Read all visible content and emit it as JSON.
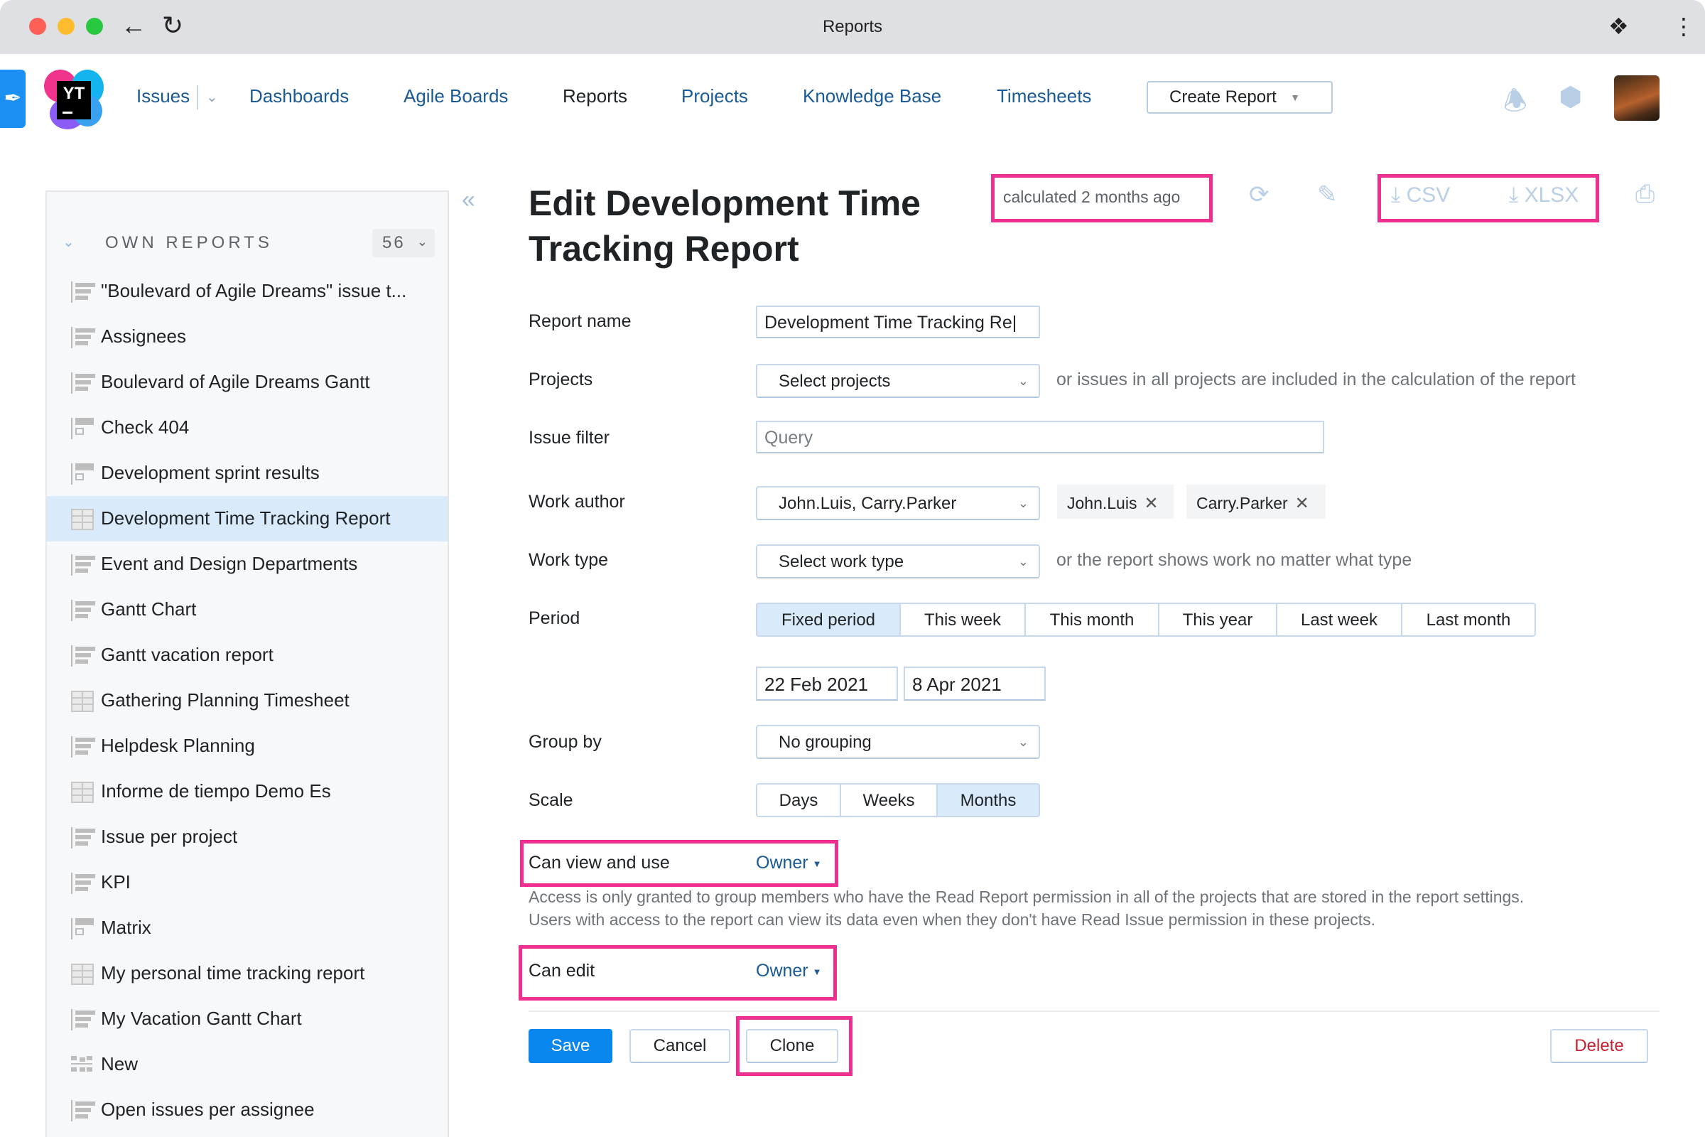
{
  "browser": {
    "title": "Reports",
    "back_icon": "arrow-left-icon",
    "reload_icon": "reload-icon",
    "extensions_icon": "puzzle-icon",
    "menu_icon": "kebab-menu-icon"
  },
  "header": {
    "logo_text": "YT",
    "nav": [
      {
        "label": "Issues",
        "active": false
      },
      {
        "label": "Dashboards",
        "active": false
      },
      {
        "label": "Agile Boards",
        "active": false
      },
      {
        "label": "Reports",
        "active": true
      },
      {
        "label": "Projects",
        "active": false
      },
      {
        "label": "Knowledge Base",
        "active": false
      },
      {
        "label": "Timesheets",
        "active": false
      }
    ],
    "create_button": "Create Report",
    "icons": [
      "bell-icon",
      "settings-icon",
      "avatar"
    ]
  },
  "sidebar": {
    "section_title": "OWN REPORTS",
    "count": "56",
    "items": [
      {
        "label": "\"Boulevard of Agile Dreams\" issue t...",
        "icon": "bar"
      },
      {
        "label": "Assignees",
        "icon": "bar"
      },
      {
        "label": "Boulevard of Agile Dreams Gantt",
        "icon": "bar"
      },
      {
        "label": "Check 404",
        "icon": "matrix"
      },
      {
        "label": "Development sprint results",
        "icon": "matrix"
      },
      {
        "label": "Development Time Tracking Report",
        "icon": "table",
        "selected": true
      },
      {
        "label": "Event and Design Departments",
        "icon": "bar"
      },
      {
        "label": "Gantt Chart",
        "icon": "bar"
      },
      {
        "label": "Gantt vacation report",
        "icon": "bar"
      },
      {
        "label": "Gathering Planning Timesheet",
        "icon": "table"
      },
      {
        "label": "Helpdesk Planning",
        "icon": "bar"
      },
      {
        "label": "Informe de tiempo Demo Es",
        "icon": "table"
      },
      {
        "label": "Issue per project",
        "icon": "bar"
      },
      {
        "label": "KPI",
        "icon": "bar"
      },
      {
        "label": "Matrix",
        "icon": "matrix"
      },
      {
        "label": "My personal time tracking report",
        "icon": "table"
      },
      {
        "label": "My Vacation Gantt Chart",
        "icon": "bar"
      },
      {
        "label": "New",
        "icon": "new"
      },
      {
        "label": "Open issues per assignee",
        "icon": "bar"
      }
    ]
  },
  "main": {
    "title": "Edit Development Time Tracking Report",
    "calculated": "calculated 2 months ago",
    "csv_label": "CSV",
    "xlsx_label": "XLSX",
    "form": {
      "report_name_label": "Report name",
      "report_name_value": "Development Time Tracking Re|",
      "projects_label": "Projects",
      "projects_placeholder": "Select projects",
      "projects_hint": "or issues in all projects are included in the calculation of the report",
      "issue_filter_label": "Issue filter",
      "issue_filter_placeholder": "Query",
      "work_author_label": "Work author",
      "work_author_value": "John.Luis, Carry.Parker",
      "work_author_tags": [
        "John.Luis",
        "Carry.Parker"
      ],
      "work_type_label": "Work type",
      "work_type_placeholder": "Select work type",
      "work_type_hint": "or the report shows work no matter what type",
      "period_label": "Period",
      "period_options": [
        "Fixed period",
        "This week",
        "This month",
        "This year",
        "Last week",
        "Last month"
      ],
      "period_selected": "Fixed period",
      "date_from": "22 Feb 2021",
      "date_to": "8 Apr 2021",
      "group_by_label": "Group by",
      "group_by_value": "No grouping",
      "scale_label": "Scale",
      "scale_options": [
        "Days",
        "Weeks",
        "Months"
      ],
      "scale_selected": "Months",
      "can_view_label": "Can view and use",
      "can_view_value": "Owner",
      "access_note_1": "Access is only granted to group members who have the Read Report permission in all of the projects that are stored in the report settings.",
      "access_note_2": "Users with access to the report can view its data even when they don't have Read Issue permission in these projects.",
      "can_edit_label": "Can edit",
      "can_edit_value": "Owner"
    },
    "buttons": {
      "save": "Save",
      "cancel": "Cancel",
      "clone": "Clone",
      "delete": "Delete"
    }
  },
  "colors": {
    "accent": "#0a87ef",
    "link": "#1a5a96",
    "highlight": "#ef2f8f",
    "selected_bg": "#d9eafb",
    "danger": "#c22333"
  }
}
